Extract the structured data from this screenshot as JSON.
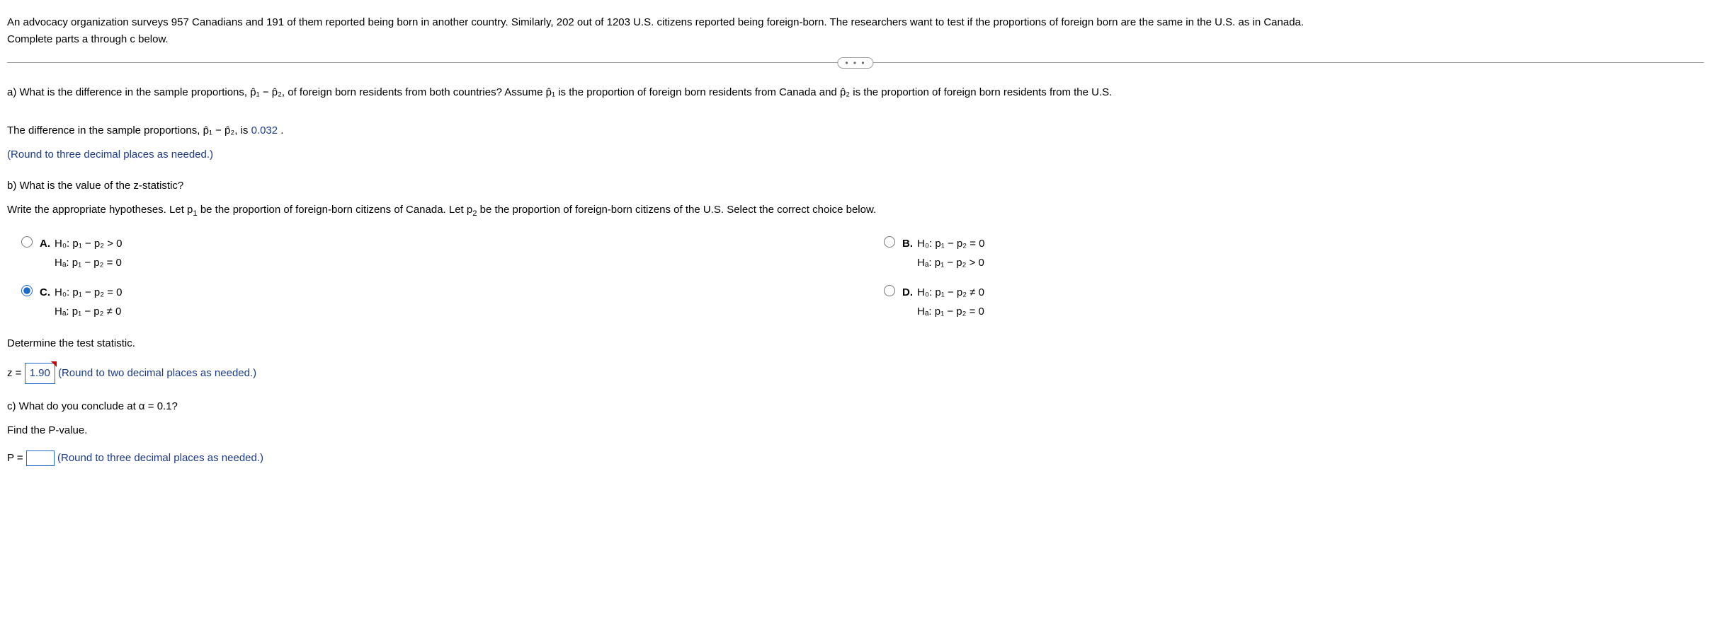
{
  "intro": {
    "line1": "An advocacy organization surveys 957 Canadians and 191 of them reported being born in another country. Similarly, 202 out of 1203 U.S. citizens reported being foreign-born. The researchers want to test if the proportions of foreign born are the same in the U.S. as in Canada.",
    "line2": "Complete parts a through c below."
  },
  "partA": {
    "prompt_pre": "a) What is the difference in the sample proportions, ",
    "prompt_mid1": ", of foreign born residents from both countries? Assume ",
    "prompt_mid2": " is the proportion of foreign born residents from Canada and ",
    "prompt_post": " is the proportion of foreign born residents from the U.S.",
    "answer_pre": "The difference in the sample proportions, ",
    "answer_mid": ", is ",
    "answer_val": "0.032",
    "answer_post": " .",
    "round_note": "(Round to three decimal places as needed.)"
  },
  "partB": {
    "heading": "b) What is the value of the z-statistic?",
    "hyp_prompt_pre": "Write the appropriate hypotheses. Let p",
    "hyp_prompt_mid": " be the proportion of foreign-born citizens of Canada. Let p",
    "hyp_prompt_post": " be the proportion of foreign-born citizens of the U.S. Select the correct choice below.",
    "options": {
      "A": {
        "label": "A.",
        "h0": "H₀: p₁ − p₂ > 0",
        "ha": "Hₐ: p₁ − p₂ = 0"
      },
      "B": {
        "label": "B.",
        "h0": "H₀: p₁ − p₂ = 0",
        "ha": "Hₐ: p₁ − p₂ > 0"
      },
      "C": {
        "label": "C.",
        "h0": "H₀: p₁ − p₂ = 0",
        "ha": "Hₐ: p₁ − p₂ ≠ 0"
      },
      "D": {
        "label": "D.",
        "h0": "H₀: p₁ − p₂ ≠ 0",
        "ha": "Hₐ: p₁ − p₂ = 0"
      }
    },
    "determine": "Determine the test statistic.",
    "z_pre": "z = ",
    "z_val": "1.90",
    "z_note": " (Round to two decimal places as needed.)"
  },
  "partC": {
    "heading": "c) What do you conclude at α = 0.1?",
    "find_p": "Find the P-value.",
    "p_pre": "P = ",
    "p_note": " (Round to three decimal places as needed.)"
  },
  "symbols": {
    "phat1": "p̂₁",
    "phat2": "p̂₂",
    "phat1_minus_phat2": "p̂₁ − p̂₂",
    "sub1": "1",
    "sub2": "2"
  },
  "expand": "• • •"
}
